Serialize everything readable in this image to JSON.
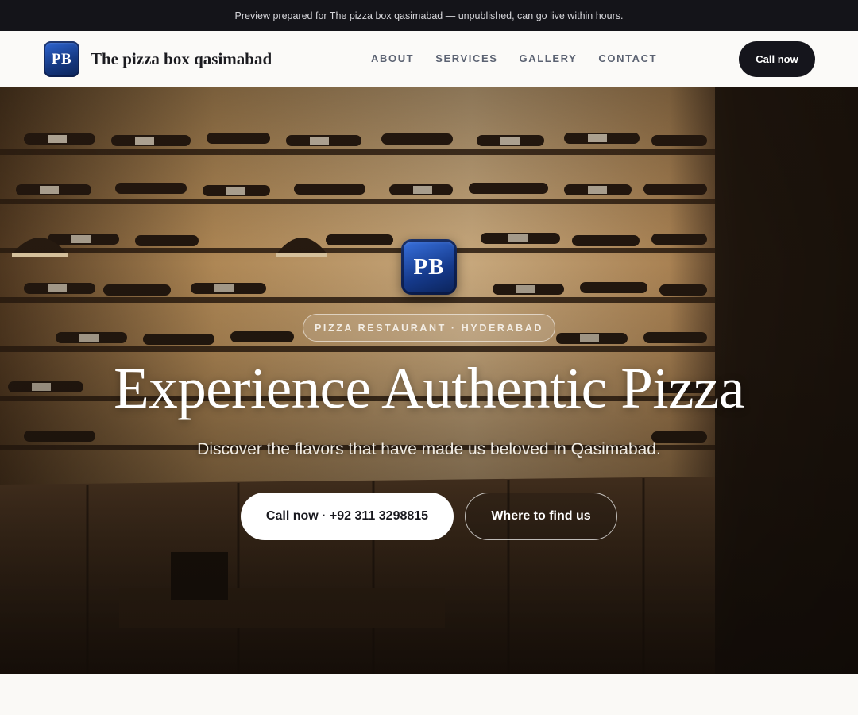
{
  "preview_banner": {
    "text": "Preview prepared for The pizza box qasimabad — unpublished, can go live within hours."
  },
  "header": {
    "logo_text": "PB",
    "brand_name": "The pizza box qasimabad",
    "nav": [
      {
        "label": "ABOUT"
      },
      {
        "label": "SERVICES"
      },
      {
        "label": "GALLERY"
      },
      {
        "label": "CONTACT"
      }
    ],
    "cta_label": "Call now"
  },
  "hero": {
    "logo_text": "PB",
    "eyebrow": "PIZZA RESTAURANT · HYDERABAD",
    "headline": "Experience Authentic Pizza",
    "subheadline": "Discover the flavors that have made us beloved in Qasimabad.",
    "primary_button": "Call now · +92 311 3298815",
    "secondary_button": "Where to find us"
  },
  "colors": {
    "banner_bg": "#141419",
    "cta_dark": "#15151c",
    "logo_blue": "#15398a",
    "page_bg": "#faf9f6"
  }
}
